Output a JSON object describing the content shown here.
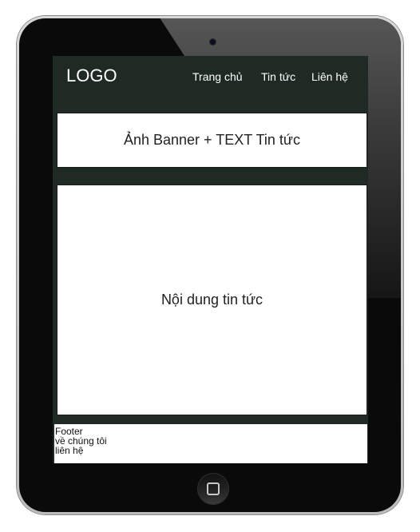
{
  "header": {
    "logo": "LOGO",
    "nav": {
      "home": "Trang chủ",
      "news": "Tin tức",
      "contact": "Liên hệ"
    }
  },
  "banner": {
    "text": "Ảnh Banner + TEXT Tin tức"
  },
  "content": {
    "text": "Nội dung tin tức"
  },
  "footer": {
    "lines": [
      "Footer",
      "về chúng tôi",
      "liên hệ"
    ]
  },
  "device": {
    "home_button_icon": "home-square-icon",
    "camera_icon": "front-camera-icon"
  },
  "colors": {
    "header_bg": "#202a25",
    "panel_bg": "#ffffff",
    "bezel": "#0a0a0a"
  }
}
